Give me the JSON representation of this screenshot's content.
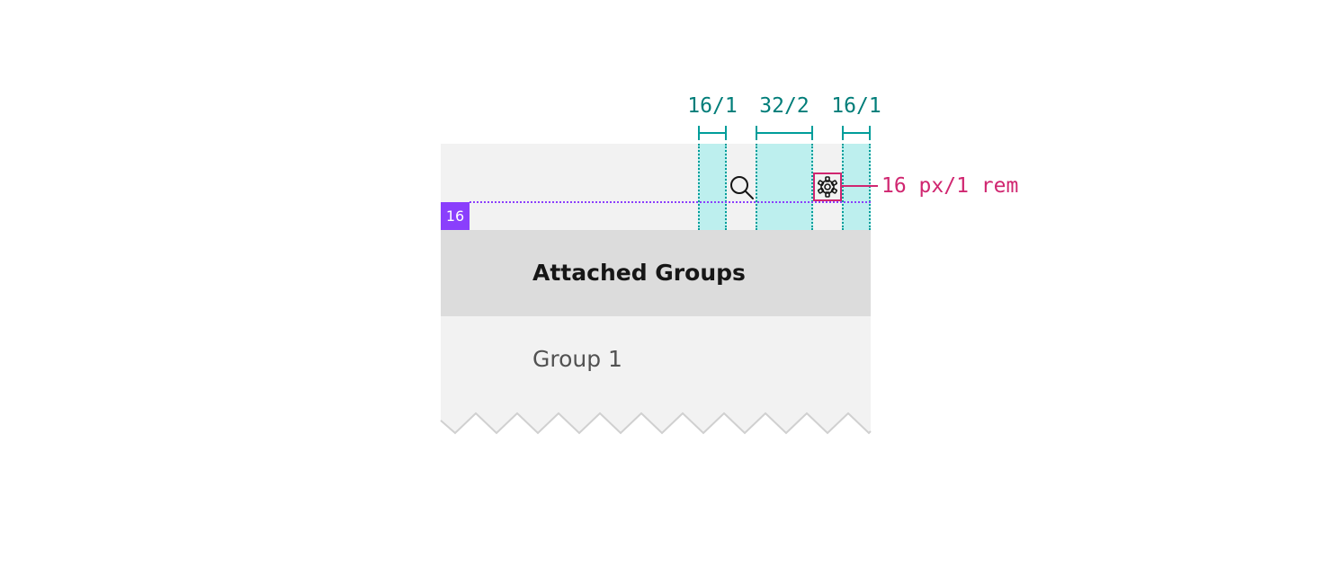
{
  "toolbar": {
    "search_icon": "search-icon",
    "settings_icon": "gear-icon"
  },
  "table": {
    "header": "Attached Groups",
    "rows": [
      "Group 1"
    ]
  },
  "annotations": {
    "spacing": [
      {
        "label": "16/1"
      },
      {
        "label": "32/2"
      },
      {
        "label": "16/1"
      }
    ],
    "padding_badge": "16",
    "icon_size": "16 px/1 rem"
  },
  "colors": {
    "toolbar_bg": "#f2f2f2",
    "header_bg": "#dcdcdc",
    "row_bg": "#f2f2f2",
    "spacing_fill": "#bdefee",
    "spacing_line": "#009d9a",
    "spacing_text": "#007d79",
    "padding_accent": "#8a3ffc",
    "icon_accent": "#d02670"
  }
}
